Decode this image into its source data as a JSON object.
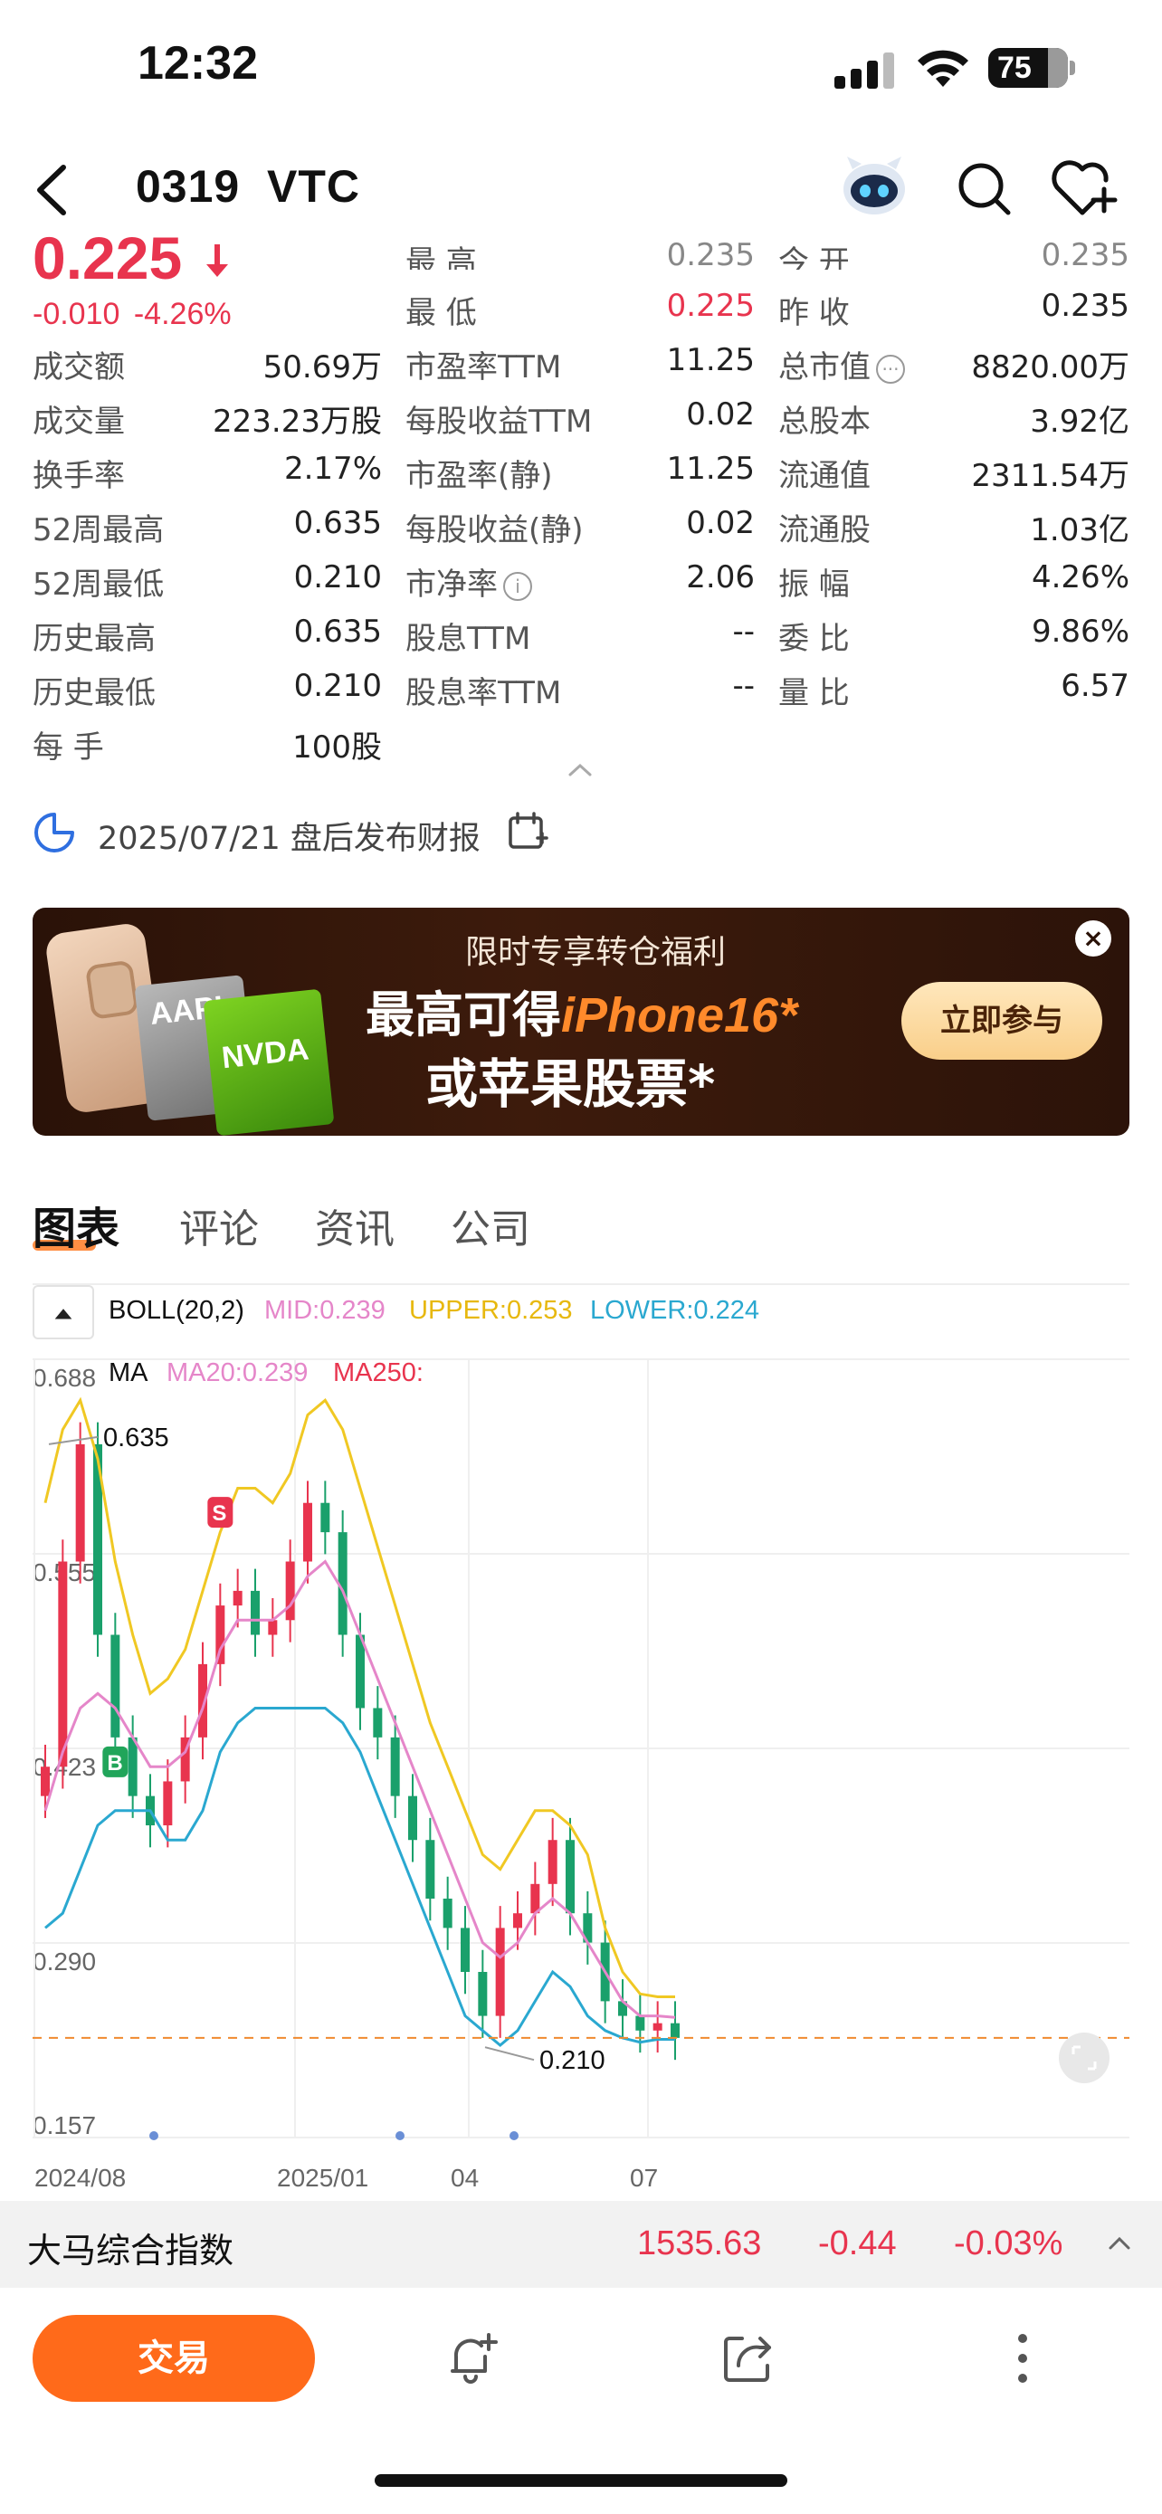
{
  "status": {
    "time": "12:32",
    "battery": "75"
  },
  "nav": {
    "title": "0319  VTC"
  },
  "quote": {
    "price": "0.225",
    "change": "-0.010",
    "change_pct": "-4.26%"
  },
  "stats_top_partial": {
    "high_label": "最 高",
    "high_value": "0.235",
    "open_label": "今 开",
    "open_value": "0.235"
  },
  "stats": {
    "low_label": "最 低",
    "low_value": "0.225",
    "prev_close_label": "昨 收",
    "prev_close_value": "0.235",
    "turnover_label": "成交额",
    "turnover_value": "50.69万",
    "pe_ttm_label": "市盈率TTM",
    "pe_ttm_value": "11.25",
    "market_cap_label": "总市值",
    "market_cap_value": "8820.00万",
    "volume_label": "成交量",
    "volume_value": "223.23万股",
    "eps_ttm_label": "每股收益TTM",
    "eps_ttm_value": "0.02",
    "total_shares_label": "总股本",
    "total_shares_value": "3.92亿",
    "turnover_rate_label": "换手率",
    "turnover_rate_value": "2.17%",
    "pe_static_label": "市盈率(静)",
    "pe_static_value": "11.25",
    "float_cap_label": "流通值",
    "float_cap_value": "2311.54万",
    "wk52_high_label": "52周最高",
    "wk52_high_value": "0.635",
    "eps_static_label": "每股收益(静)",
    "eps_static_value": "0.02",
    "float_shares_label": "流通股",
    "float_shares_value": "1.03亿",
    "wk52_low_label": "52周最低",
    "wk52_low_value": "0.210",
    "pb_label": "市净率",
    "pb_value": "2.06",
    "amplitude_label": "振 幅",
    "amplitude_value": "4.26%",
    "hist_high_label": "历史最高",
    "hist_high_value": "0.635",
    "div_ttm_label": "股息TTM",
    "div_ttm_value": "--",
    "bid_ratio_label": "委 比",
    "bid_ratio_value": "9.86%",
    "hist_low_label": "历史最低",
    "hist_low_value": "0.210",
    "div_yield_label": "股息率TTM",
    "div_yield_value": "--",
    "vol_ratio_label": "量 比",
    "vol_ratio_value": "6.57",
    "lot_label": "每 手",
    "lot_value": "100股"
  },
  "report": {
    "text": "2025/07/21 盘后发布财报"
  },
  "banner": {
    "subtitle": "限时专享转仓福利",
    "line1_prefix": "最高可得",
    "line1_highlight": "iPhone16*",
    "line2": "或苹果股票*",
    "cta": "立即参与",
    "card1": "AAPL",
    "card2": "NVDA",
    "close": "×"
  },
  "tabs": [
    "图表",
    "评论",
    "资讯",
    "公司"
  ],
  "indicators": {
    "boll": "BOLL(20,2)",
    "mid": "MID:0.239",
    "upper": "UPPER:0.253",
    "lower": "LOWER:0.224",
    "ma": "MA",
    "ma20": "MA20:0.239",
    "ma250": "MA250:"
  },
  "colors": {
    "up": "#e8344e",
    "down": "#1aa06b",
    "mid": "#e586c9",
    "upper": "#f0c823",
    "lower": "#2aa8d0",
    "accent": "#ff6a1a"
  },
  "chart_data": {
    "type": "candlestick",
    "y_ticks": [
      "0.688",
      "0.555",
      "0.423",
      "0.290",
      "0.157"
    ],
    "ylim": [
      0.157,
      0.688
    ],
    "x_labels": [
      "2024/08",
      "2025/01",
      "04",
      "07"
    ],
    "current_price": 0.225,
    "max_label": "0.635",
    "min_label": "0.210",
    "markers": [
      {
        "type": "B",
        "date_index": 4
      },
      {
        "type": "S",
        "date_index": 10
      }
    ],
    "series": [
      {
        "name": "close",
        "values": [
          0.41,
          0.55,
          0.63,
          0.5,
          0.43,
          0.39,
          0.37,
          0.4,
          0.43,
          0.48,
          0.52,
          0.53,
          0.5,
          0.51,
          0.55,
          0.59,
          0.57,
          0.5,
          0.45,
          0.43,
          0.39,
          0.36,
          0.32,
          0.3,
          0.27,
          0.24,
          0.3,
          0.31,
          0.33,
          0.36,
          0.31,
          0.29,
          0.25,
          0.24,
          0.23,
          0.235,
          0.225
        ]
      },
      {
        "name": "MID",
        "values": [
          0.38,
          0.42,
          0.45,
          0.46,
          0.45,
          0.43,
          0.41,
          0.41,
          0.42,
          0.45,
          0.49,
          0.51,
          0.51,
          0.51,
          0.52,
          0.54,
          0.55,
          0.53,
          0.5,
          0.47,
          0.44,
          0.41,
          0.38,
          0.35,
          0.32,
          0.29,
          0.28,
          0.29,
          0.31,
          0.32,
          0.31,
          0.29,
          0.27,
          0.25,
          0.24,
          0.24,
          0.239
        ]
      },
      {
        "name": "UPPER",
        "values": [
          0.59,
          0.64,
          0.66,
          0.62,
          0.55,
          0.5,
          0.46,
          0.47,
          0.49,
          0.53,
          0.57,
          0.6,
          0.6,
          0.59,
          0.61,
          0.65,
          0.66,
          0.64,
          0.6,
          0.56,
          0.52,
          0.48,
          0.44,
          0.41,
          0.38,
          0.35,
          0.34,
          0.36,
          0.38,
          0.38,
          0.37,
          0.35,
          0.3,
          0.27,
          0.255,
          0.253,
          0.253
        ]
      },
      {
        "name": "LOWER",
        "values": [
          0.3,
          0.31,
          0.34,
          0.37,
          0.38,
          0.38,
          0.38,
          0.36,
          0.36,
          0.38,
          0.42,
          0.44,
          0.45,
          0.45,
          0.45,
          0.45,
          0.45,
          0.44,
          0.42,
          0.39,
          0.36,
          0.33,
          0.3,
          0.27,
          0.24,
          0.23,
          0.22,
          0.23,
          0.25,
          0.27,
          0.26,
          0.24,
          0.23,
          0.225,
          0.222,
          0.224,
          0.224
        ]
      }
    ]
  },
  "bottom_index": {
    "name": "大马综合指数",
    "value": "1535.63",
    "change": "-0.44",
    "change_pct": "-0.03%"
  },
  "toolbar": {
    "trade": "交易"
  }
}
